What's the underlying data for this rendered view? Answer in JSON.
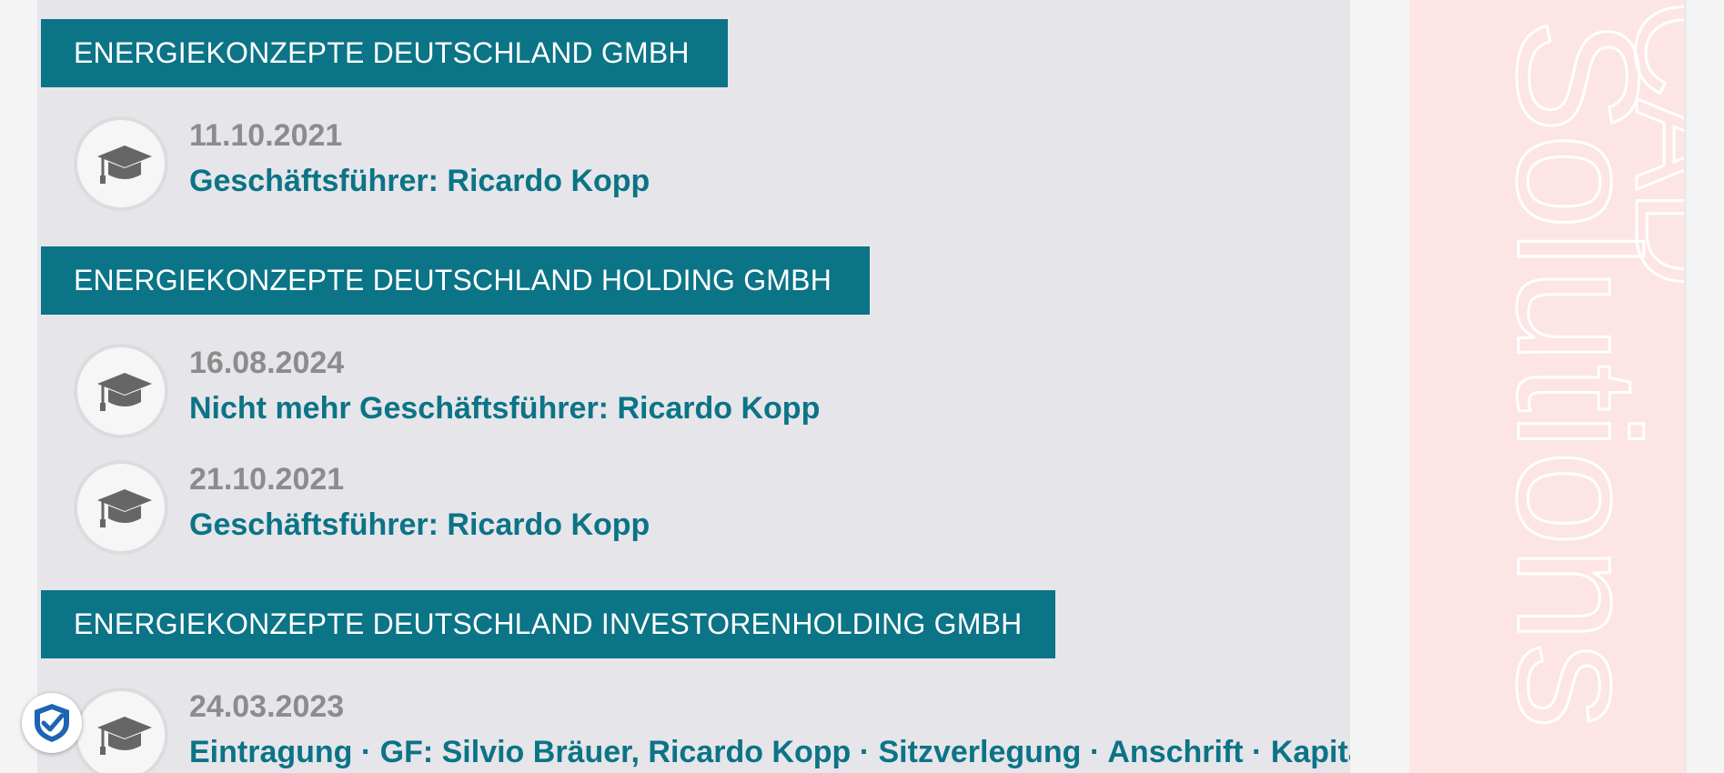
{
  "sections": [
    {
      "company": "ENERGIEKONZEPTE DEUTSCHLAND GMBH",
      "entries": [
        {
          "date": "11.10.2021",
          "title": "Geschäftsführer: Ricardo Kopp",
          "icon": "graduation-cap-icon"
        }
      ]
    },
    {
      "company": "ENERGIEKONZEPTE DEUTSCHLAND HOLDING GMBH",
      "entries": [
        {
          "date": "16.08.2024",
          "title": "Nicht mehr Geschäftsführer: Ricardo Kopp",
          "icon": "graduation-cap-icon"
        },
        {
          "date": "21.10.2021",
          "title": "Geschäftsführer: Ricardo Kopp",
          "icon": "graduation-cap-icon"
        }
      ]
    },
    {
      "company": "ENERGIEKONZEPTE DEUTSCHLAND INVESTORENHOLDING GMBH",
      "entries": [
        {
          "date": "24.03.2023",
          "title": "Eintragung · GF: Silvio Bräuer, Ricardo Kopp · Sitzverlegung · Anschrift · Kapital:",
          "icon": "graduation-cap-icon"
        }
      ]
    }
  ],
  "ad": {
    "line1": "CAD",
    "line2": "Solutions"
  },
  "badge": {
    "icon": "checkmark-shield-icon"
  },
  "colors": {
    "accent": "#0b7486",
    "date": "#8c8c8c",
    "panel": "#e6e5ea",
    "ad_background": "#fde5e5"
  }
}
